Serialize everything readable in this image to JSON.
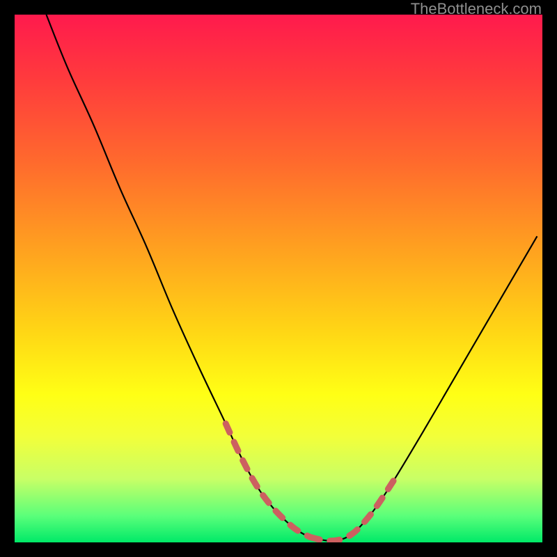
{
  "watermark": {
    "text": "TheBottleneck.com"
  },
  "chart_data": {
    "type": "line",
    "title": "",
    "xlabel": "",
    "ylabel": "",
    "xlim": [
      0,
      100
    ],
    "ylim": [
      0,
      100
    ],
    "grid": false,
    "legend": false,
    "background": "rainbow-gradient (red top → green bottom)",
    "series": [
      {
        "name": "curve",
        "color": "#000000",
        "x": [
          6,
          10,
          15,
          20,
          25,
          30,
          35,
          40,
          43,
          46,
          49,
          52,
          54,
          56,
          58,
          60,
          62,
          63.5,
          65,
          68,
          72,
          78,
          85,
          92,
          99
        ],
        "y": [
          100,
          90,
          79,
          67,
          56,
          44,
          33,
          22.5,
          16,
          10.5,
          6.5,
          3.5,
          2,
          1,
          0.5,
          0.3,
          0.6,
          1.3,
          2.5,
          6,
          12,
          22,
          34,
          46,
          58
        ]
      },
      {
        "name": "dashed-left-segment",
        "color": "#cc6060",
        "style": "dashed",
        "x": [
          40,
          43,
          46,
          49,
          52,
          54,
          56
        ],
        "y": [
          22.5,
          16,
          10.5,
          6.5,
          3.5,
          2,
          1
        ]
      },
      {
        "name": "dashed-bottom-segment",
        "color": "#cc6060",
        "style": "dashed",
        "x": [
          56,
          58,
          60,
          62,
          63.5
        ],
        "y": [
          1,
          0.5,
          0.3,
          0.6,
          1.3
        ]
      },
      {
        "name": "dashed-right-segment",
        "color": "#cc6060",
        "style": "dashed",
        "x": [
          63.5,
          65,
          68,
          72
        ],
        "y": [
          1.3,
          2.5,
          6,
          12
        ]
      }
    ]
  }
}
